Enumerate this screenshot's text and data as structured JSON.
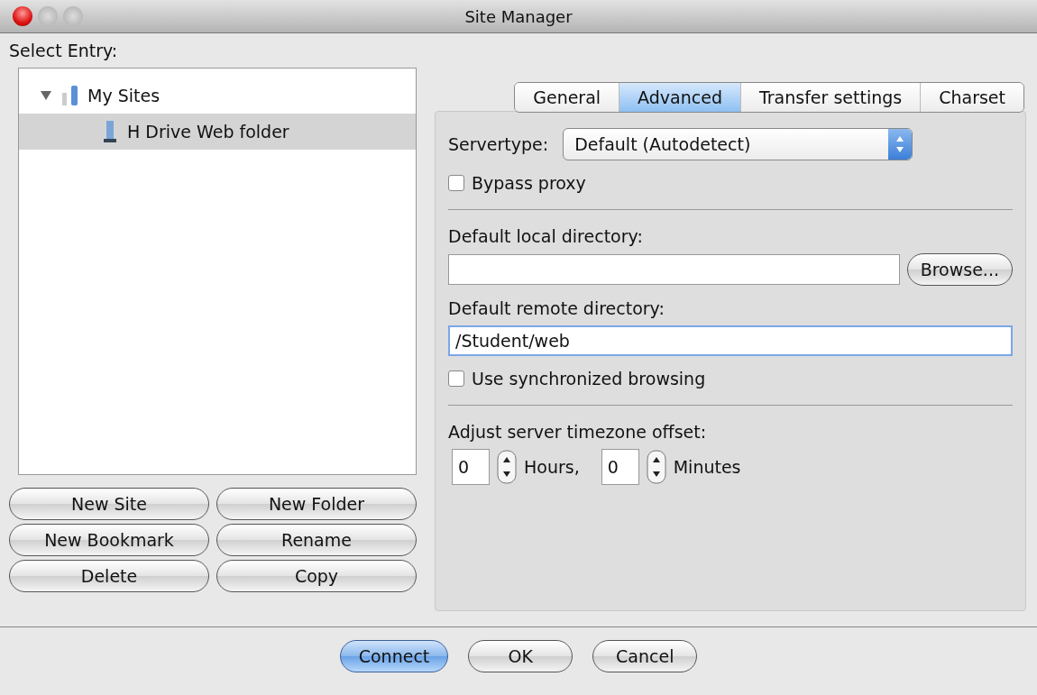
{
  "window": {
    "title": "Site Manager"
  },
  "entries": {
    "label": "Select Entry:",
    "tree": [
      {
        "label": "My Sites",
        "kind": "folder",
        "expanded": true,
        "selected": false,
        "children": [
          {
            "label": "H Drive Web folder",
            "kind": "site",
            "selected": true
          }
        ]
      }
    ],
    "buttons": [
      "New Site",
      "New Folder",
      "New Bookmark",
      "Rename",
      "Delete",
      "Copy"
    ]
  },
  "tabs": [
    {
      "label": "General",
      "selected": false
    },
    {
      "label": "Advanced",
      "selected": true
    },
    {
      "label": "Transfer settings",
      "selected": false
    },
    {
      "label": "Charset",
      "selected": false
    }
  ],
  "advanced": {
    "servertype": {
      "label": "Servertype:",
      "value": "Default (Autodetect)"
    },
    "bypass_proxy": {
      "label": "Bypass proxy",
      "checked": false
    },
    "local_directory": {
      "label": "Default local directory:",
      "button": "Browse..."
    },
    "remote_directory": {
      "label": "Default remote directory:",
      "value": "/Student/web"
    },
    "synchronized_browsing": {
      "label": "Use synchronized browsing",
      "checked": false
    },
    "timezone": {
      "label": "Adjust server timezone offset:",
      "hours": "0",
      "hours_unit": "Hours,",
      "minutes": "0",
      "minutes_unit": "Minutes"
    }
  },
  "footer": [
    {
      "label": "Connect",
      "default": true
    },
    {
      "label": "OK",
      "default": false
    },
    {
      "label": "Cancel",
      "default": false
    }
  ]
}
